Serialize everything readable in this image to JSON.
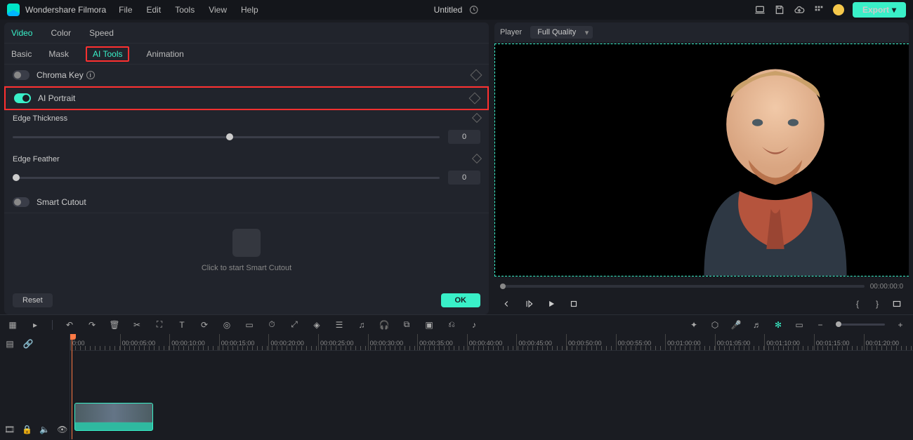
{
  "app": {
    "name": "Wondershare Filmora"
  },
  "menu": [
    "File",
    "Edit",
    "Tools",
    "View",
    "Help"
  ],
  "project": {
    "title": "Untitled"
  },
  "export": {
    "label": "Export"
  },
  "tabs": {
    "main": [
      "Video",
      "Color",
      "Speed"
    ],
    "active": "Video",
    "sub": [
      "Basic",
      "Mask",
      "AI Tools",
      "Animation"
    ],
    "subActive": "AI Tools"
  },
  "sections": {
    "chromaKey": {
      "label": "Chroma Key",
      "on": false
    },
    "aiPortrait": {
      "label": "AI Portrait",
      "on": true
    },
    "smartCutout": {
      "label": "Smart Cutout",
      "on": false,
      "hint": "Click to start Smart Cutout"
    }
  },
  "sliders": {
    "edgeThickness": {
      "label": "Edge Thickness",
      "value": "0",
      "pos": "50%"
    },
    "edgeFeather": {
      "label": "Edge Feather",
      "value": "0",
      "pos": "0%"
    }
  },
  "buttons": {
    "reset": "Reset",
    "ok": "OK"
  },
  "player": {
    "label": "Player",
    "quality": "Full Quality",
    "time": "00:00:00:0"
  },
  "ruler": [
    "0:00",
    "00:00:05:00",
    "00:00:10:00",
    "00:00:15:00",
    "00:00:20:00",
    "00:00:25:00",
    "00:00:30:00",
    "00:00:35:00",
    "00:00:40:00",
    "00:00:45:00",
    "00:00:50:00",
    "00:00:55:00",
    "00:01:00:00",
    "00:01:05:00",
    "00:01:10:00",
    "00:01:15:00",
    "00:01:20:00"
  ]
}
